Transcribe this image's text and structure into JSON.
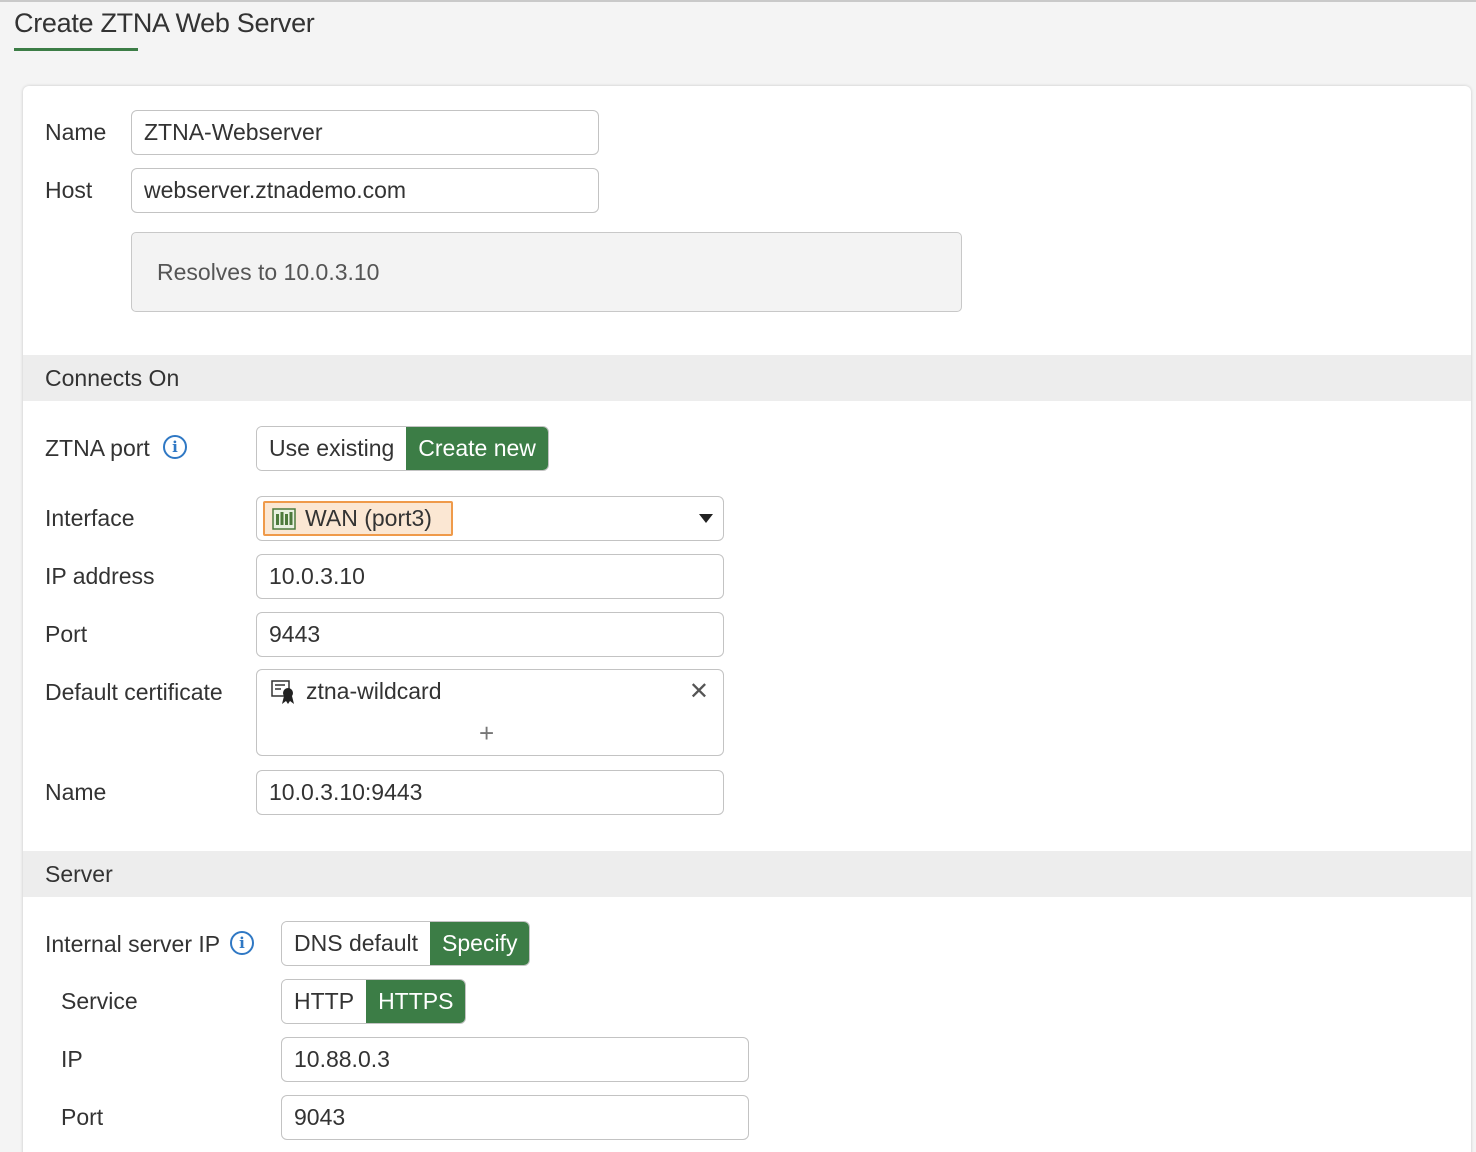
{
  "page": {
    "title": "Create ZTNA Web Server"
  },
  "general": {
    "name_label": "Name",
    "name_value": "ZTNA-Webserver",
    "host_label": "Host",
    "host_value": "webserver.ztnademo.com",
    "resolve_note": "Resolves to 10.0.3.10"
  },
  "connects_on": {
    "section_title": "Connects On",
    "ztna_port_label": "ZTNA port",
    "ztna_port_options": [
      "Use existing",
      "Create new"
    ],
    "ztna_port_selected": "Create new",
    "interface_label": "Interface",
    "interface_value": "WAN (port3)",
    "ip_label": "IP address",
    "ip_value": "10.0.3.10",
    "port_label": "Port",
    "port_value": "9443",
    "cert_label": "Default certificate",
    "cert_value": "ztna-wildcard",
    "cert_remove_glyph": "✕",
    "cert_add_glyph": "+",
    "name_label": "Name",
    "name_value": "10.0.3.10:9443"
  },
  "server": {
    "section_title": "Server",
    "internal_ip_label": "Internal server IP",
    "internal_ip_options": [
      "DNS default",
      "Specify"
    ],
    "internal_ip_selected": "Specify",
    "service_label": "Service",
    "service_options": [
      "HTTP",
      "HTTPS"
    ],
    "service_selected": "HTTPS",
    "ip_label": "IP",
    "ip_value": "10.88.0.3",
    "port_label": "Port",
    "port_value": "9043"
  },
  "icons": {
    "info": "info-icon",
    "interface": "network-port-icon",
    "certificate": "certificate-icon",
    "info_glyph": "i"
  },
  "colors": {
    "accent": "#3c7d46",
    "info": "#2f78c4",
    "chip_bg": "#fbe7d3",
    "chip_border": "#ef9a4a",
    "section_bg": "#ededed"
  }
}
